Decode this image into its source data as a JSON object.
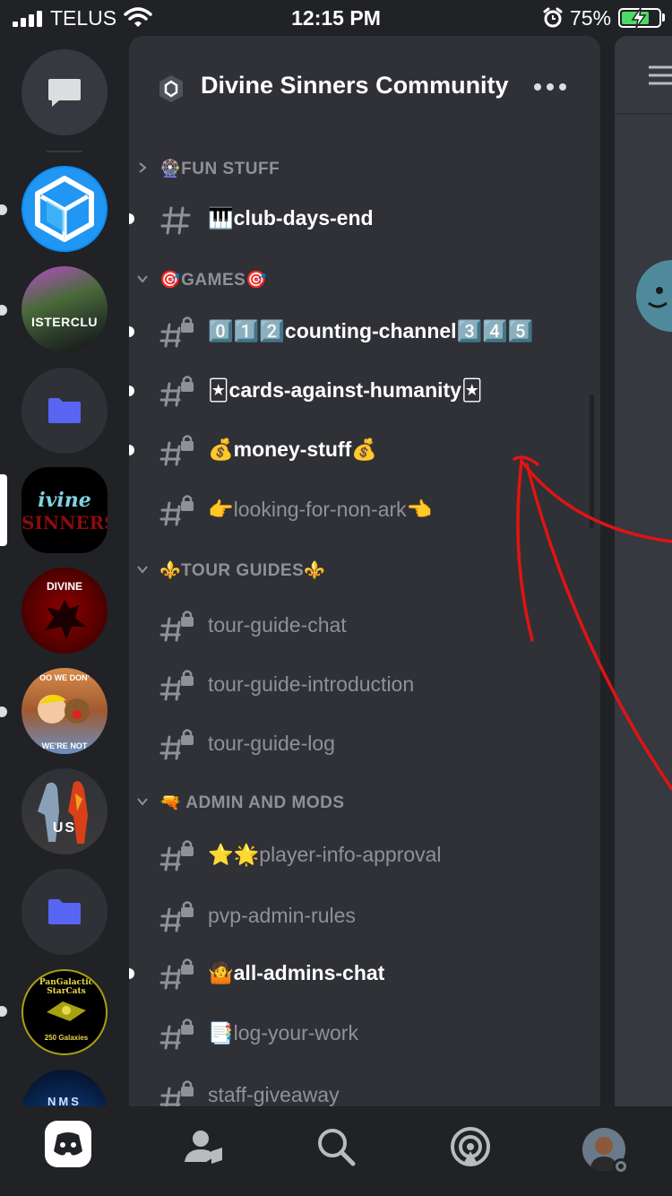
{
  "status_bar": {
    "carrier": "TELUS",
    "time": "12:15 PM",
    "battery_percent": "75%",
    "battery_level": 0.75,
    "icons": [
      "signal-icon",
      "wifi-icon",
      "alarm-icon",
      "battery-charging-icon"
    ]
  },
  "rail": {
    "servers": [
      {
        "name": "server-cube",
        "icon": "cube-icon"
      },
      {
        "name": "server-sisterclub",
        "label": "ISTERCLU"
      },
      {
        "name": "folder",
        "icon": "folder-icon"
      },
      {
        "name": "server-divine-sinners",
        "label_top": "ivine",
        "label_bottom": "SINNERS",
        "active": true
      },
      {
        "name": "server-divine",
        "label": "DIVINE"
      },
      {
        "name": "server-meme",
        "label_top": "OO WE DON'",
        "label_bottom": "WE'RE NOT"
      },
      {
        "name": "server-us",
        "label": "US"
      },
      {
        "name": "folder-2",
        "icon": "folder-icon"
      },
      {
        "name": "server-starcats",
        "label_top": "PanGalactic StarCats",
        "label_bottom": "250 Galaxies"
      },
      {
        "name": "server-nms",
        "label": "NMS"
      }
    ]
  },
  "panel": {
    "server_name": "Divine Sinners Community",
    "categories": [
      {
        "label": "🎡FUN STUFF",
        "collapsed": true
      },
      {
        "label": "🎯GAMES🎯",
        "collapsed": false
      },
      {
        "label": "⚜️TOUR GUIDES⚜️",
        "collapsed": false
      },
      {
        "label": "🔫 ADMIN AND MODS",
        "collapsed": false
      }
    ],
    "channels": [
      {
        "name": "🎹club-days-end",
        "unread": true,
        "locked": false
      },
      {
        "name": "0️⃣1️⃣2️⃣counting-channel3️⃣4️⃣5️⃣",
        "unread": true,
        "locked": true
      },
      {
        "name": "🃏cards-against-humanity🃏",
        "unread": true,
        "locked": true
      },
      {
        "name": "💰money-stuff💰",
        "unread": true,
        "locked": true
      },
      {
        "name": "👉looking-for-non-ark👈",
        "unread": false,
        "locked": true
      },
      {
        "name": "tour-guide-chat",
        "unread": false,
        "locked": true
      },
      {
        "name": "tour-guide-introduction",
        "unread": false,
        "locked": true
      },
      {
        "name": "tour-guide-log",
        "unread": false,
        "locked": true
      },
      {
        "name": "⭐🌟player-info-approval",
        "unread": false,
        "locked": true
      },
      {
        "name": "pvp-admin-rules",
        "unread": false,
        "locked": true
      },
      {
        "name": "🤷all-admins-chat",
        "unread": true,
        "locked": true
      },
      {
        "name": "📑log-your-work",
        "unread": false,
        "locked": true
      },
      {
        "name": "staff-giveaway",
        "unread": false,
        "locked": true
      }
    ]
  },
  "bottom_nav": {
    "items": [
      "discord-home-icon",
      "friends-icon",
      "search-icon",
      "mentions-icon",
      "profile-avatar"
    ]
  },
  "colors": {
    "background": "#202225",
    "panel": "#2f3136",
    "muted_text": "#8e9297",
    "annotation_red": "#e01414"
  }
}
